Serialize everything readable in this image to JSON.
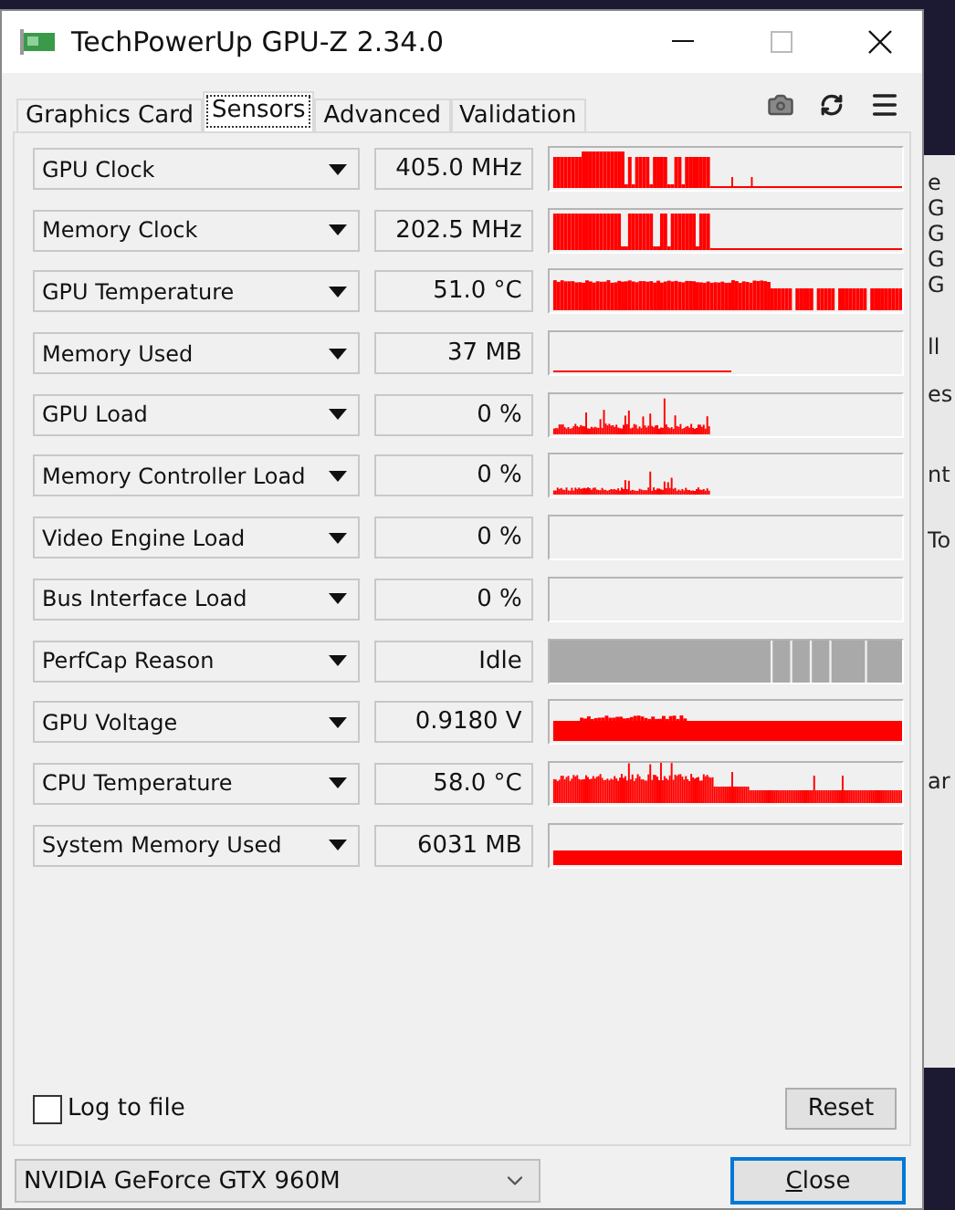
{
  "window": {
    "title": "TechPowerUp GPU-Z 2.34.0"
  },
  "tabs": [
    {
      "label": "Graphics Card",
      "selected": false
    },
    {
      "label": "Sensors",
      "selected": true
    },
    {
      "label": "Advanced",
      "selected": false
    },
    {
      "label": "Validation",
      "selected": false
    }
  ],
  "sensors": [
    {
      "name": "GPU Clock",
      "value": "405.0 MHz"
    },
    {
      "name": "Memory Clock",
      "value": "202.5 MHz"
    },
    {
      "name": "GPU Temperature",
      "value": "51.0 °C"
    },
    {
      "name": "Memory Used",
      "value": "37 MB"
    },
    {
      "name": "GPU Load",
      "value": "0 %"
    },
    {
      "name": "Memory Controller Load",
      "value": "0 %"
    },
    {
      "name": "Video Engine Load",
      "value": "0 %"
    },
    {
      "name": "Bus Interface Load",
      "value": "0 %"
    },
    {
      "name": "PerfCap Reason",
      "value": "Idle"
    },
    {
      "name": "GPU Voltage",
      "value": "0.9180 V"
    },
    {
      "name": "CPU Temperature",
      "value": "58.0 °C"
    },
    {
      "name": "System Memory Used",
      "value": "6031 MB"
    }
  ],
  "log_to_file": {
    "label": "Log to file",
    "checked": false
  },
  "reset_button": "Reset",
  "gpu_select": {
    "value": "NVIDIA GeForce GTX 960M"
  },
  "close_button": "Close",
  "background_window": {
    "texts": [
      "e",
      "G",
      "G",
      "G",
      "G",
      "ll",
      "es",
      "nt",
      "To",
      "ar"
    ]
  }
}
